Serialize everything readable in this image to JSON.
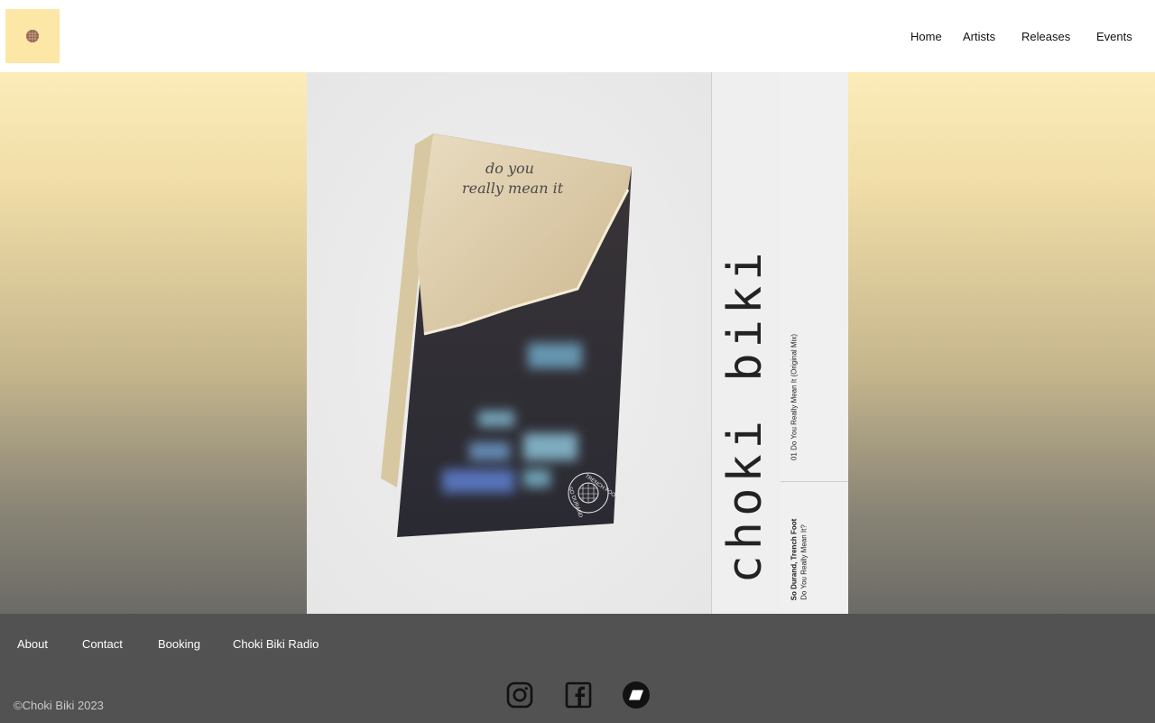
{
  "header": {
    "logo_icon": "choki-biki-logo-icon",
    "nav": [
      {
        "label": "Home"
      },
      {
        "label": "Artists"
      },
      {
        "label": "Releases"
      },
      {
        "label": "Events"
      }
    ]
  },
  "release": {
    "handwriting_line1": "do you",
    "handwriting_line2": "really mean it",
    "brand": "choki biki",
    "track": "01 Do You Really Mean It (Original Mix)",
    "artists": "So Durand, Trench Foot",
    "title": "Do You Really Mean It?",
    "stamp_top": "TRENCH FOOT",
    "stamp_bottom": "SO DURAND"
  },
  "footer": {
    "links": [
      {
        "label": "About"
      },
      {
        "label": "Contact"
      },
      {
        "label": "Booking"
      },
      {
        "label": "Choki Biki Radio"
      }
    ],
    "copyright": "©Choki Biki 2023",
    "social_icons": [
      "instagram-icon",
      "facebook-icon",
      "bandcamp-icon"
    ]
  },
  "colors": {
    "logo_bg": "#fde7a7",
    "footer_bg": "#525252",
    "hero_top": "#fbecb9",
    "hero_bottom": "#6b6a66"
  }
}
